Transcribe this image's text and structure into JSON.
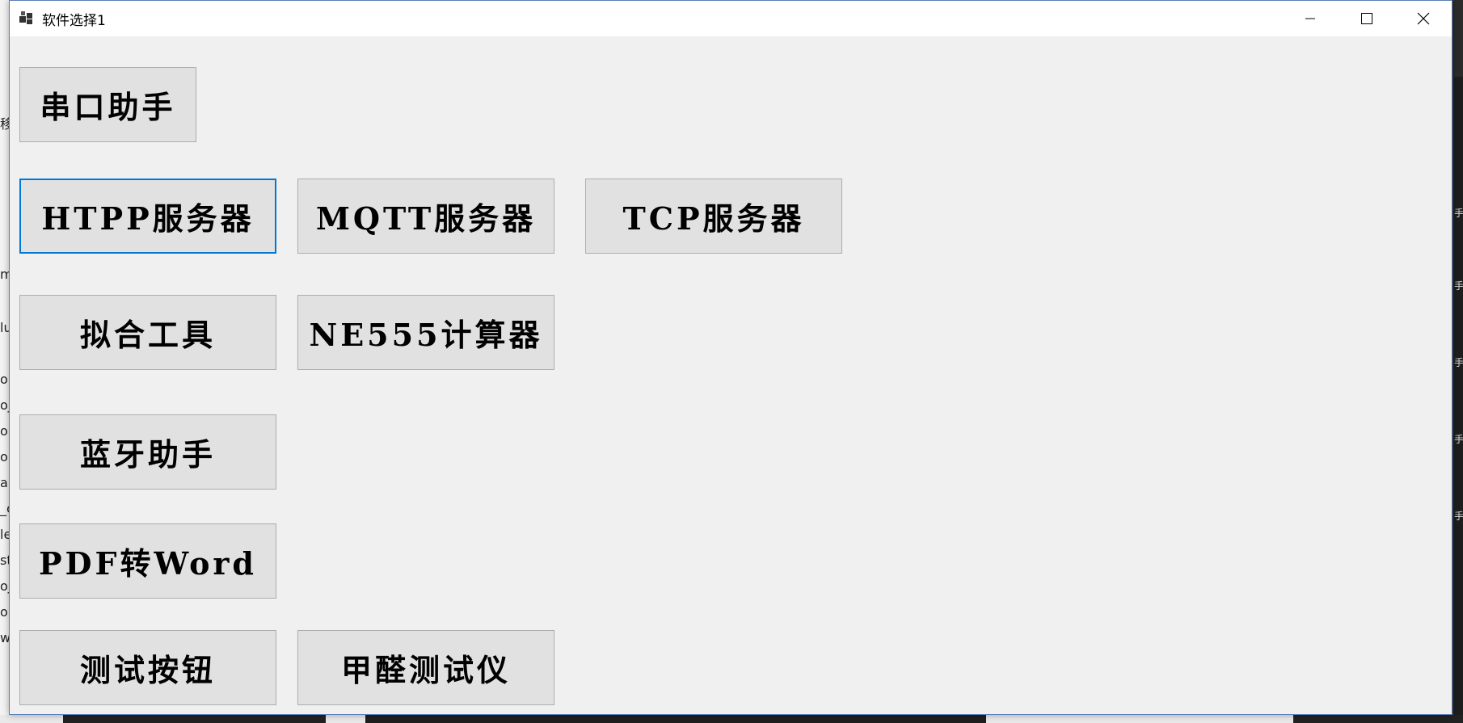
{
  "window": {
    "title": "软件选择1"
  },
  "buttons": {
    "serial": "串口助手",
    "http": "HTPP服务器",
    "mqtt": "MQTT服务器",
    "tcp": "TCP服务器",
    "fit": "拟合工具",
    "ne555": "NE555计算器",
    "bluetooth": "蓝牙助手",
    "pdf": "PDF转Word",
    "test": "测试按钮",
    "formaldehyde": "甲醛测试仪"
  },
  "background": {
    "left_fragments": [
      "移",
      "m",
      "lu",
      "ob",
      "oj",
      "ol",
      "o",
      "a",
      "_c",
      "le",
      "st",
      "oj",
      "ol",
      "w"
    ],
    "right_fragments": [
      "手",
      "手",
      "手",
      "手",
      "手"
    ]
  },
  "colors": {
    "accent": "#0078d7",
    "button_bg": "#e1e1e1",
    "button_border": "#adadad",
    "window_bg": "#f0f0f0"
  }
}
